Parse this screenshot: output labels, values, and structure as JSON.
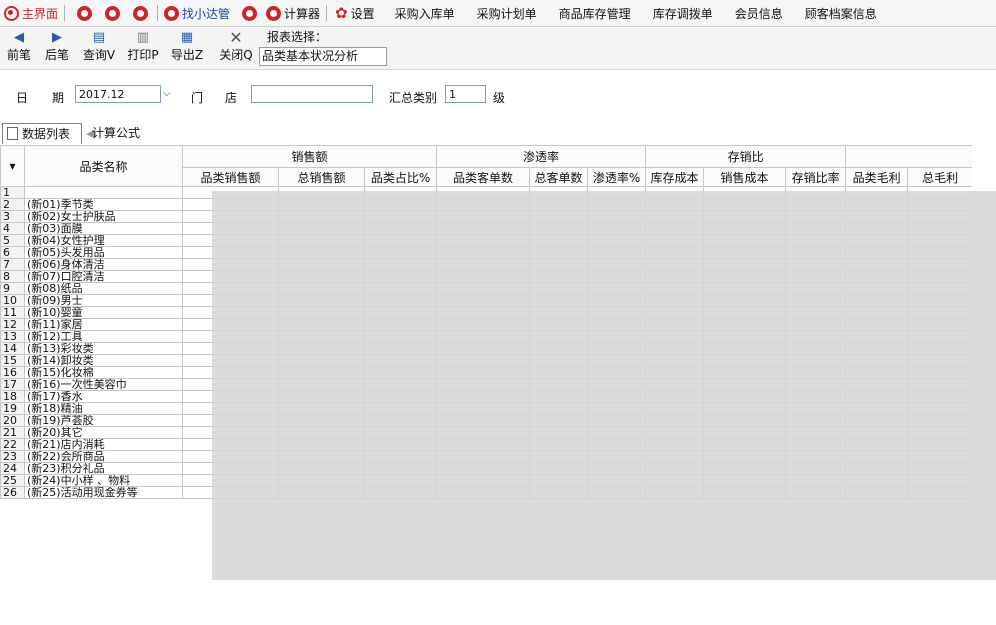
{
  "menu": {
    "items": [
      {
        "label": "主界面",
        "icon": "home-icon",
        "style": "red"
      },
      {
        "label": "",
        "icon": "circle-icon-1",
        "style": "icon"
      },
      {
        "label": "",
        "icon": "circle-icon-2",
        "style": "icon"
      },
      {
        "label": "",
        "icon": "circle-icon-3",
        "style": "icon"
      },
      {
        "label": "找小达管",
        "icon": "search-helper-icon",
        "style": "blue"
      },
      {
        "label": "",
        "icon": "circle-icon-4",
        "style": "icon"
      },
      {
        "label": "计算器",
        "icon": "calculator-icon",
        "style": "plain"
      },
      {
        "label": "设置",
        "icon": "gear-icon",
        "style": "plain"
      },
      {
        "label": "采购入库单",
        "style": "text"
      },
      {
        "label": "采购计划单",
        "style": "text"
      },
      {
        "label": "商品库存管理",
        "style": "text"
      },
      {
        "label": "库存调拨单",
        "style": "text"
      },
      {
        "label": "会员信息",
        "style": "text"
      },
      {
        "label": "顾客档案信息",
        "style": "text"
      }
    ]
  },
  "toolbar": {
    "prev": "前笔",
    "next": "后笔",
    "query": "查询Ⅴ",
    "print": "打印P",
    "export": "导出Z",
    "close": "关闭Q",
    "report_label": "报表选择：",
    "report_value": "品类基本状况分析"
  },
  "filter": {
    "date_label_1": "日",
    "date_label_2": "期",
    "date_value": "2017.12",
    "store_label_1": "门",
    "store_label_2": "店",
    "store_value": "",
    "level_label": "汇总类别",
    "level_value": "1",
    "level_unit": "级"
  },
  "tabs": {
    "data_list": "数据列表",
    "formula": "计算公式"
  },
  "grid": {
    "row_header_glyph": "▾",
    "name_header": "品类名称",
    "groups": [
      "销售额",
      "渗透率",
      "存销比"
    ],
    "columns": [
      "品类销售额",
      "总销售额",
      "品类占比%",
      "品类客单数",
      "总客单数",
      "渗透率%",
      "库存成本",
      "销售成本",
      "存销比率",
      "品类毛利",
      "总毛利"
    ],
    "rows": [
      {
        "n": "1",
        "name": ""
      },
      {
        "n": "2",
        "name": "(新01)季节类"
      },
      {
        "n": "3",
        "name": "(新02)女士护肤品"
      },
      {
        "n": "4",
        "name": "(新03)面膜"
      },
      {
        "n": "5",
        "name": "(新04)女性护理"
      },
      {
        "n": "6",
        "name": "(新05)头发用品"
      },
      {
        "n": "7",
        "name": "(新06)身体清洁"
      },
      {
        "n": "8",
        "name": "(新07)口腔清洁"
      },
      {
        "n": "9",
        "name": "(新08)纸品"
      },
      {
        "n": "10",
        "name": "(新09)男士"
      },
      {
        "n": "11",
        "name": "(新10)婴童"
      },
      {
        "n": "12",
        "name": "(新11)家居"
      },
      {
        "n": "13",
        "name": "(新12)工具"
      },
      {
        "n": "14",
        "name": "(新13)彩妆类"
      },
      {
        "n": "15",
        "name": "(新14)卸妆类"
      },
      {
        "n": "16",
        "name": "(新15)化妆棉"
      },
      {
        "n": "17",
        "name": "(新16)一次性美容巾"
      },
      {
        "n": "18",
        "name": "(新17)香水"
      },
      {
        "n": "19",
        "name": "(新18)精油"
      },
      {
        "n": "20",
        "name": "(新19)芦荟胶"
      },
      {
        "n": "21",
        "name": "(新20)其它"
      },
      {
        "n": "22",
        "name": "(新21)店内消耗"
      },
      {
        "n": "23",
        "name": "(新22)会所商品"
      },
      {
        "n": "24",
        "name": "(新23)积分礼品"
      },
      {
        "n": "25",
        "name": "(新24)中小样 、物料"
      },
      {
        "n": "26",
        "name": "(新25)活动用现金券等"
      }
    ]
  }
}
